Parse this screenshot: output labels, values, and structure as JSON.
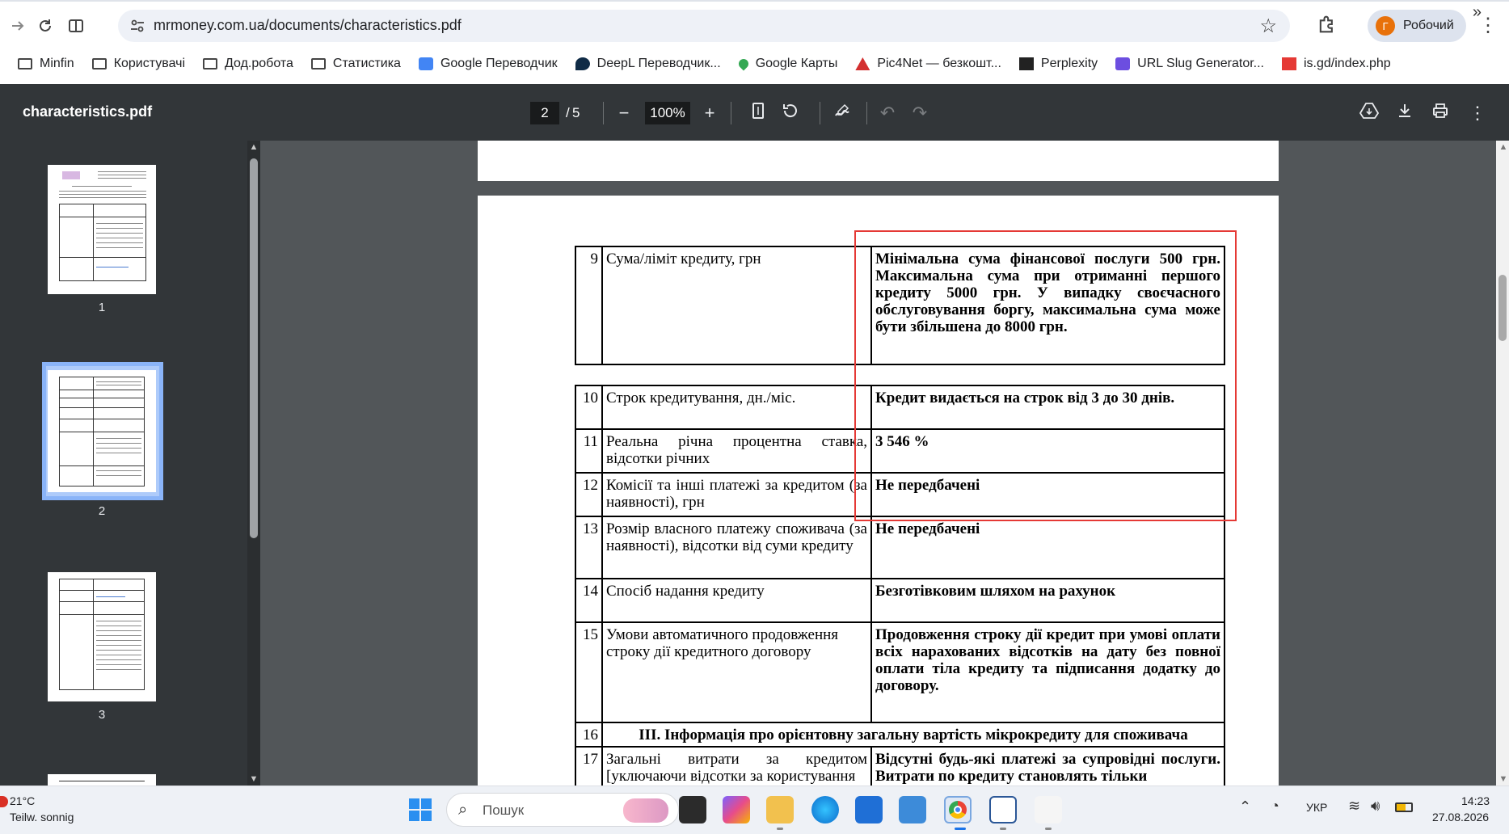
{
  "browser": {
    "url": "mrmoney.com.ua/documents/characteristics.pdf",
    "profile_initial": "Г",
    "profile_name": "Робочий",
    "bookmarks": [
      {
        "label": "Minfin",
        "icon": "folder-icon"
      },
      {
        "label": "Користувачі",
        "icon": "folder-icon"
      },
      {
        "label": "Дод.робота",
        "icon": "folder-icon"
      },
      {
        "label": "Статистика",
        "icon": "folder-icon"
      },
      {
        "label": "Google Переводчик",
        "icon": "google-translate-icon"
      },
      {
        "label": "DeepL Переводчик...",
        "icon": "deepl-icon"
      },
      {
        "label": "Google Карты",
        "icon": "google-maps-icon"
      },
      {
        "label": "Pic4Net — безкошт...",
        "icon": "pic4net-icon"
      },
      {
        "label": "Perplexity",
        "icon": "perplexity-icon"
      },
      {
        "label": "URL Slug Generator...",
        "icon": "slug-generator-icon"
      },
      {
        "label": "is.gd/index.php",
        "icon": "isgd-icon"
      }
    ]
  },
  "pdf": {
    "filename": "characteristics.pdf",
    "current_page": "2",
    "page_separator": "/",
    "total_pages": "5",
    "zoom": "100%",
    "thumbnails": [
      "1",
      "2",
      "3"
    ]
  },
  "document": {
    "rows": [
      {
        "num": "9",
        "label": "Сума/ліміт кредиту, грн",
        "value": "Мінімальна сума фінансової послуги 500 грн. Максимальна сума при отриманні першого кредиту 5000 грн. У випадку своєчасного обслуговування боргу, максимальна сума може бути збільшена до 8000 грн."
      },
      {
        "num": "10",
        "label": "Строк кредитування, дн./міс.",
        "value": "Кредит видається на строк від 3 до 30 днів."
      },
      {
        "num": "11",
        "label": "Реальна річна процентна ставка, відсотки річних",
        "value": "3 546 %"
      },
      {
        "num": "12",
        "label": "Комісії та інші платежі за кредитом (за наявності), грн",
        "value": "Не передбачені"
      },
      {
        "num": "13",
        "label": "Розмір власного платежу споживача (за наявності), відсотки від суми кредиту",
        "value": "Не передбачені"
      },
      {
        "num": "14",
        "label": "Спосіб надання кредиту",
        "value": "Безготівковим шляхом на рахунок"
      },
      {
        "num": "15",
        "label": "Умови автоматичного продовження строку дії кредитного договору",
        "value": "Продовження строку дії кредит при умові оплати всіх нарахованих відсотків на дату без повної оплати тіла кредиту та підписання додатку до договору."
      },
      {
        "num": "16",
        "section_title": "ІІІ. Інформація про орієнтовну загальну вартість мікрокредиту для споживача"
      },
      {
        "num": "17",
        "label": "Загальні витрати за кредитом [уключаючи відсотки за користування",
        "value": "Відсутні будь-які платежі за супровідні послуги. Витрати по кредиту становлять тільки"
      }
    ]
  },
  "taskbar": {
    "weather_temp": "21°C",
    "weather_desc": "Teilw. sonnig",
    "search_placeholder": "Пошук",
    "language": "УКР",
    "time": "14:23",
    "date": "27.08.2026"
  },
  "colors": {
    "pdf_toolbar": "#323639",
    "viewer_bg": "#525659",
    "highlight_frame": "#e53935",
    "selected_thumb": "#8ab4f8"
  }
}
